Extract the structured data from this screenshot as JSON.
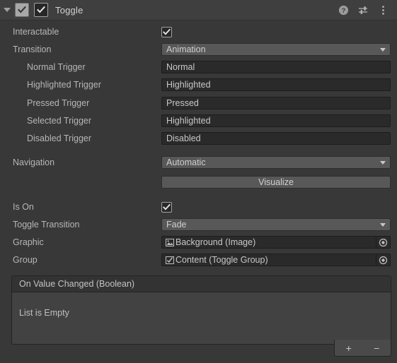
{
  "header": {
    "title": "Toggle",
    "foldout_icon": "triangle-down-icon",
    "component_icon": "toggle-component-icon",
    "enabled_checkbox": "✔",
    "help_icon": "?",
    "preset_icon": "preset-sliders-icon",
    "menu_icon": "kebab-menu-icon"
  },
  "properties": {
    "interactable": {
      "label": "Interactable",
      "checked": "✔"
    },
    "transition": {
      "label": "Transition",
      "value": "Animation"
    },
    "normal_trigger": {
      "label": "Normal Trigger",
      "value": "Normal"
    },
    "highlighted_trigger": {
      "label": "Highlighted Trigger",
      "value": "Highlighted"
    },
    "pressed_trigger": {
      "label": "Pressed Trigger",
      "value": "Pressed"
    },
    "selected_trigger": {
      "label": "Selected Trigger",
      "value": "Highlighted"
    },
    "disabled_trigger": {
      "label": "Disabled Trigger",
      "value": "Disabled"
    },
    "navigation": {
      "label": "Navigation",
      "value": "Automatic"
    },
    "visualize": {
      "label": "Visualize"
    },
    "is_on": {
      "label": "Is On",
      "checked": "✔"
    },
    "toggle_transition": {
      "label": "Toggle Transition",
      "value": "Fade"
    },
    "graphic": {
      "label": "Graphic",
      "value": "Background (Image)",
      "icon": "image-asset-icon"
    },
    "group": {
      "label": "Group",
      "value": "Content (Toggle Group)",
      "icon": "toggle-group-icon"
    }
  },
  "event_list": {
    "title": "On Value Changed (Boolean)",
    "empty_text": "List is Empty",
    "add_label": "+",
    "remove_label": "−"
  }
}
